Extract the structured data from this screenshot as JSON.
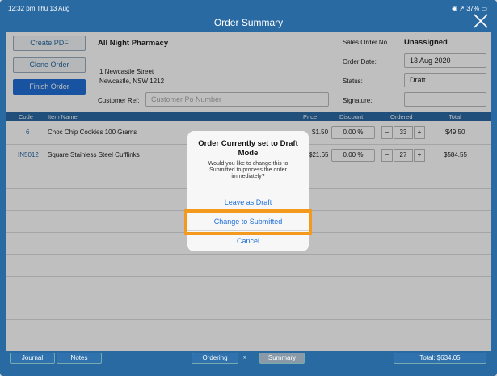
{
  "status_bar": {
    "time": "12:32 pm  Thu 13 Aug",
    "right": "◉ ➚ 37% ▭"
  },
  "title": "Order Summary",
  "sidebar": {
    "create_pdf": "Create PDF",
    "clone_order": "Clone Order",
    "finish_order": "Finish Order"
  },
  "customer": {
    "name": "All Night Pharmacy",
    "address1": "1 Newcastle Street",
    "address2": "Newcastle, NSW 1212",
    "ref_label": "Customer Ref:",
    "ref_placeholder": "Customer Po Number"
  },
  "order_meta": {
    "so_label": "Sales Order No.:",
    "so_value": "Unassigned",
    "date_label": "Order Date:",
    "date_value": "13 Aug 2020",
    "status_label": "Status:",
    "status_value": "Draft",
    "signature_label": "Signature:"
  },
  "table": {
    "headers": {
      "code": "Code",
      "item": "Item Name",
      "price": "Price",
      "discount": "Discount",
      "ordered": "Ordered",
      "total": "Total"
    },
    "rows": [
      {
        "code": "6",
        "item": "Choc Chip Cookies 100 Grams",
        "price": "$1.50",
        "discount": "0.00 %",
        "qty": "33",
        "total": "$49.50"
      },
      {
        "code": "IN5012",
        "item": "Square Stainless Steel Cufflinks",
        "price": "$21.65",
        "discount": "0.00 %",
        "qty": "27",
        "total": "$584.55"
      }
    ],
    "minus": "−",
    "plus": "+"
  },
  "bottom_bar": {
    "journal": "Journal",
    "notes": "Notes",
    "ordering": "Ordering",
    "arrow": "»",
    "summary": "Summary",
    "total": "Total: $634.05"
  },
  "dialog": {
    "title": "Order Currently set to Draft Mode",
    "message": "Would you like to change this to Submitted to process the order immediately?",
    "leave_draft": "Leave as Draft",
    "change_submitted": "Change to Submitted",
    "cancel": "Cancel"
  },
  "colors": {
    "brand": "#2a6aa3",
    "accent": "#1f6fd6",
    "highlight": "#f39a1e"
  }
}
